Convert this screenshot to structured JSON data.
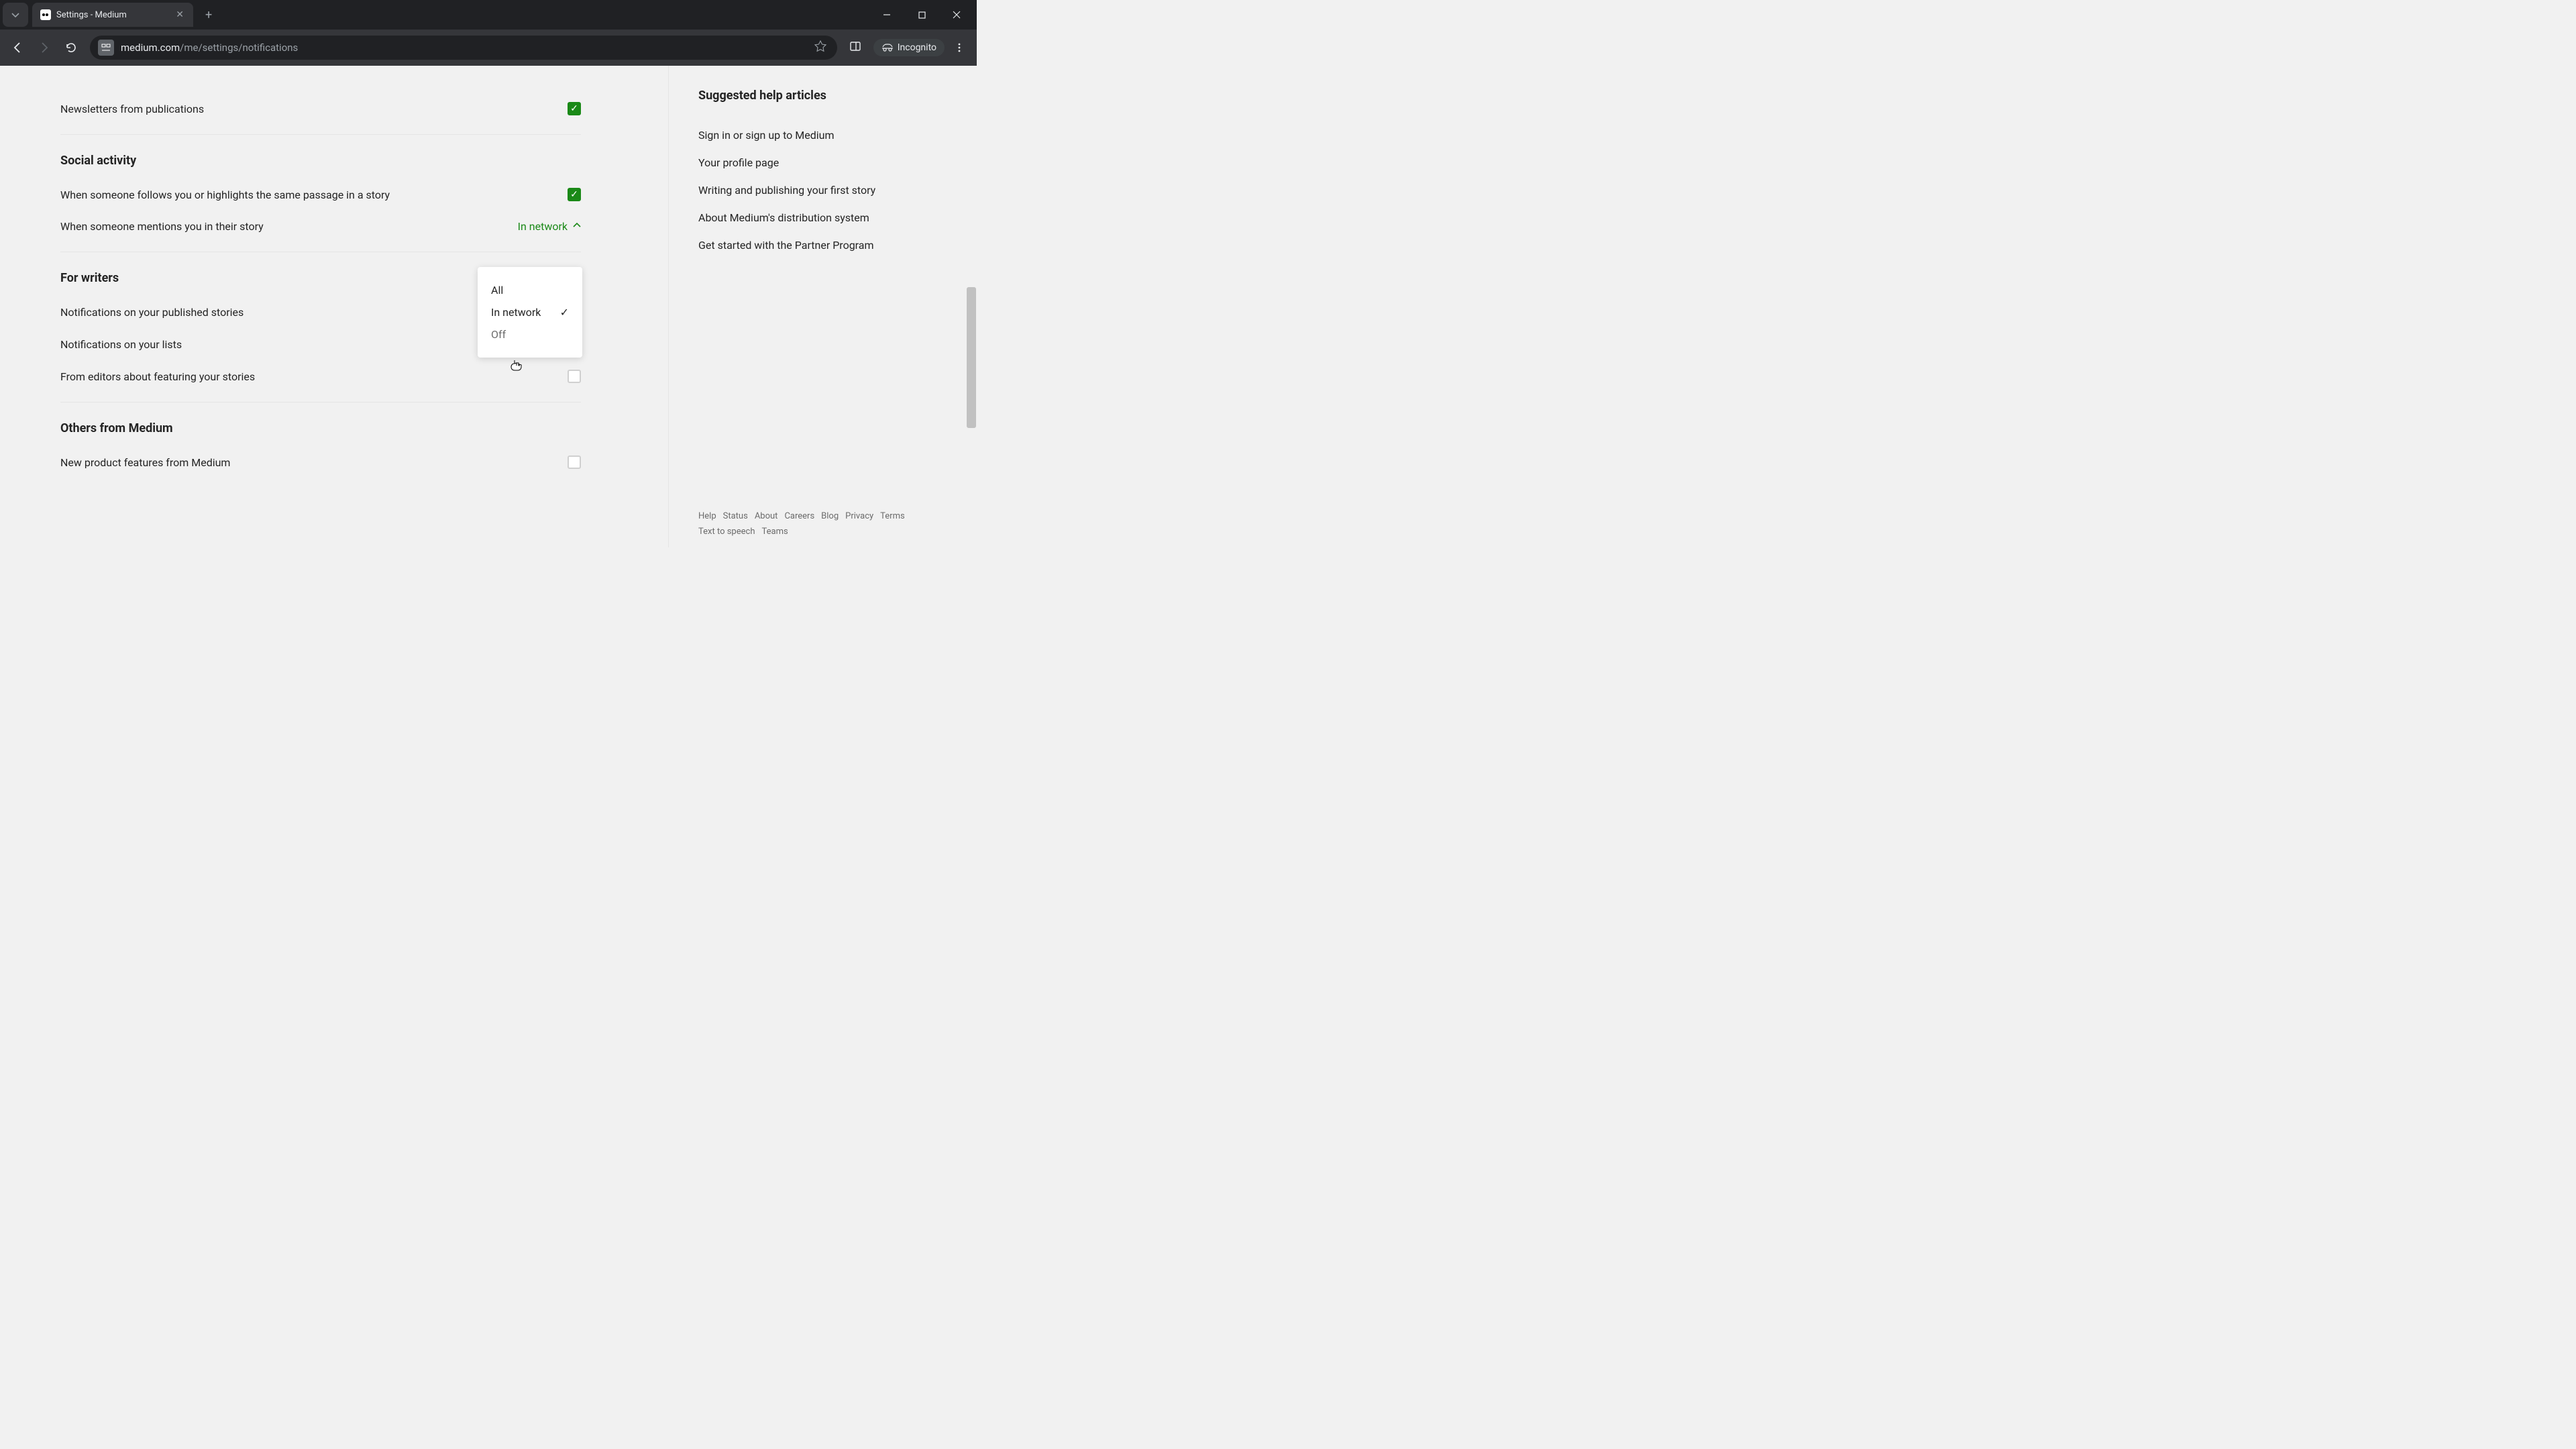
{
  "browser": {
    "tab_title": "Settings - Medium",
    "url_display_prefix": "medium.com",
    "url_display_suffix": "/me/settings/notifications",
    "incognito_label": "Incognito"
  },
  "settings": {
    "newsletters_label": "Newsletters from publications",
    "social_header": "Social activity",
    "social_follow_label": "When someone follows you or highlights the same passage in a story",
    "social_mention_label": "When someone mentions you in their story",
    "mention_value": "In network",
    "mention_options": {
      "all": "All",
      "in_network": "In network",
      "off": "Off"
    },
    "writers_header": "For writers",
    "writers_published_label": "Notifications on your published stories",
    "writers_lists_label": "Notifications on your lists",
    "writers_editors_label": "From editors about featuring your stories",
    "others_header": "Others from Medium",
    "others_product_label": "New product features from Medium"
  },
  "sidebar": {
    "header": "Suggested help articles",
    "links": {
      "signin": "Sign in or sign up to Medium",
      "profile": "Your profile page",
      "writing": "Writing and publishing your first story",
      "distribution": "About Medium's distribution system",
      "partner": "Get started with the Partner Program"
    }
  },
  "footer": {
    "help": "Help",
    "status": "Status",
    "about": "About",
    "careers": "Careers",
    "blog": "Blog",
    "privacy": "Privacy",
    "terms": "Terms",
    "tts": "Text to speech",
    "teams": "Teams"
  }
}
